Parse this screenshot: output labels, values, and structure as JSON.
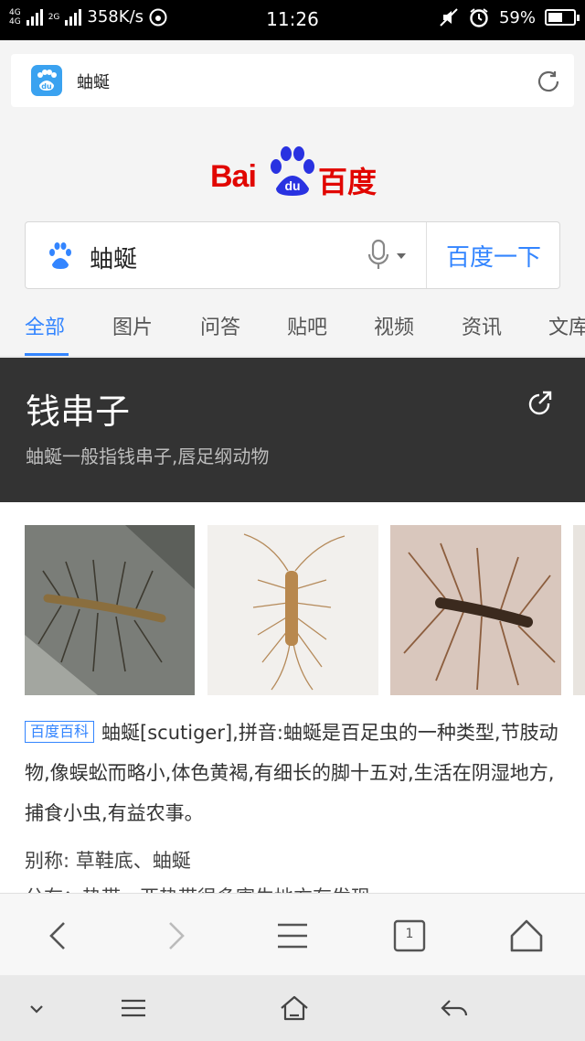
{
  "status_bar": {
    "network_1": "4G",
    "network_2": "4G",
    "network_3": "2G",
    "speed": "358K/s",
    "time": "11:26",
    "battery": "59%",
    "battery_level": 0.59
  },
  "url_bar": {
    "title": "蚰蜒",
    "logo_text": "du"
  },
  "logo": {
    "latin": "Bai",
    "paw_text": "du",
    "chinese": "百度"
  },
  "search": {
    "query": "蚰蜒",
    "button": "百度一下"
  },
  "tabs": [
    "全部",
    "图片",
    "问答",
    "贴吧",
    "视频",
    "资讯",
    "文库"
  ],
  "card": {
    "title": "钱串子",
    "subtitle": "蚰蜒一般指钱串子,唇足纲动物",
    "source_badge": "百度百科",
    "description": "蚰蜒[scutiger],拼音:蚰蜒是百足虫的一种类型,节肢动物,像蜈蚣而略小,体色黄褐,有细长的脚十五对,生活在阴湿地方,捕食小虫,有益农事。",
    "alias_label": "别称:",
    "alias_value": "草鞋底、蚰蜒",
    "next_line": "分布：热带、亚热带很多寄生地方有发现"
  },
  "toolbar": {
    "tab_count": "1"
  },
  "colors": {
    "accent": "#3385ff",
    "baidu_red": "#e10601",
    "baidu_blue": "#2932e1",
    "header_dark": "#333333"
  }
}
